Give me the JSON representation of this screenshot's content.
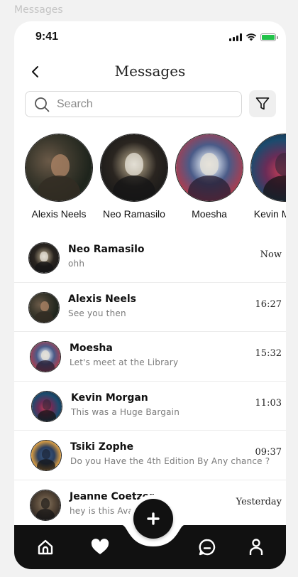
{
  "frame_label": "Messages",
  "status_bar": {
    "time": "9:41"
  },
  "header": {
    "title": "Messages"
  },
  "search": {
    "placeholder": "Search"
  },
  "stories": [
    {
      "name": "Alexis Neels"
    },
    {
      "name": "Neo Ramasilo"
    },
    {
      "name": "Moesha"
    },
    {
      "name": "Kevin Morgan"
    }
  ],
  "messages": [
    {
      "name": "Neo Ramasilo",
      "preview": "ohh",
      "time": "Now"
    },
    {
      "name": "Alexis Neels",
      "preview": "See you then",
      "time": "16:27"
    },
    {
      "name": "Moesha",
      "preview": "Let's meet at the Library",
      "time": "15:32"
    },
    {
      "name": "Kevin Morgan",
      "preview": "This was a Huge Bargain",
      "time": "11:03"
    },
    {
      "name": "Tsiki Zophe",
      "preview": "Do you Have the 4th  Edition By Any chance ?",
      "time": "09:37"
    },
    {
      "name": "Jeanne Coetzer",
      "preview": "hey is this Available?",
      "time": "Yesterday"
    }
  ],
  "tabbar": {
    "tabs": [
      "home-icon",
      "heart-icon",
      "chat-icon",
      "profile-icon"
    ],
    "fab_icon": "plus-icon"
  },
  "colors": {
    "battery": "#22c24a",
    "tabbar": "#111111",
    "accent": "#111111"
  }
}
